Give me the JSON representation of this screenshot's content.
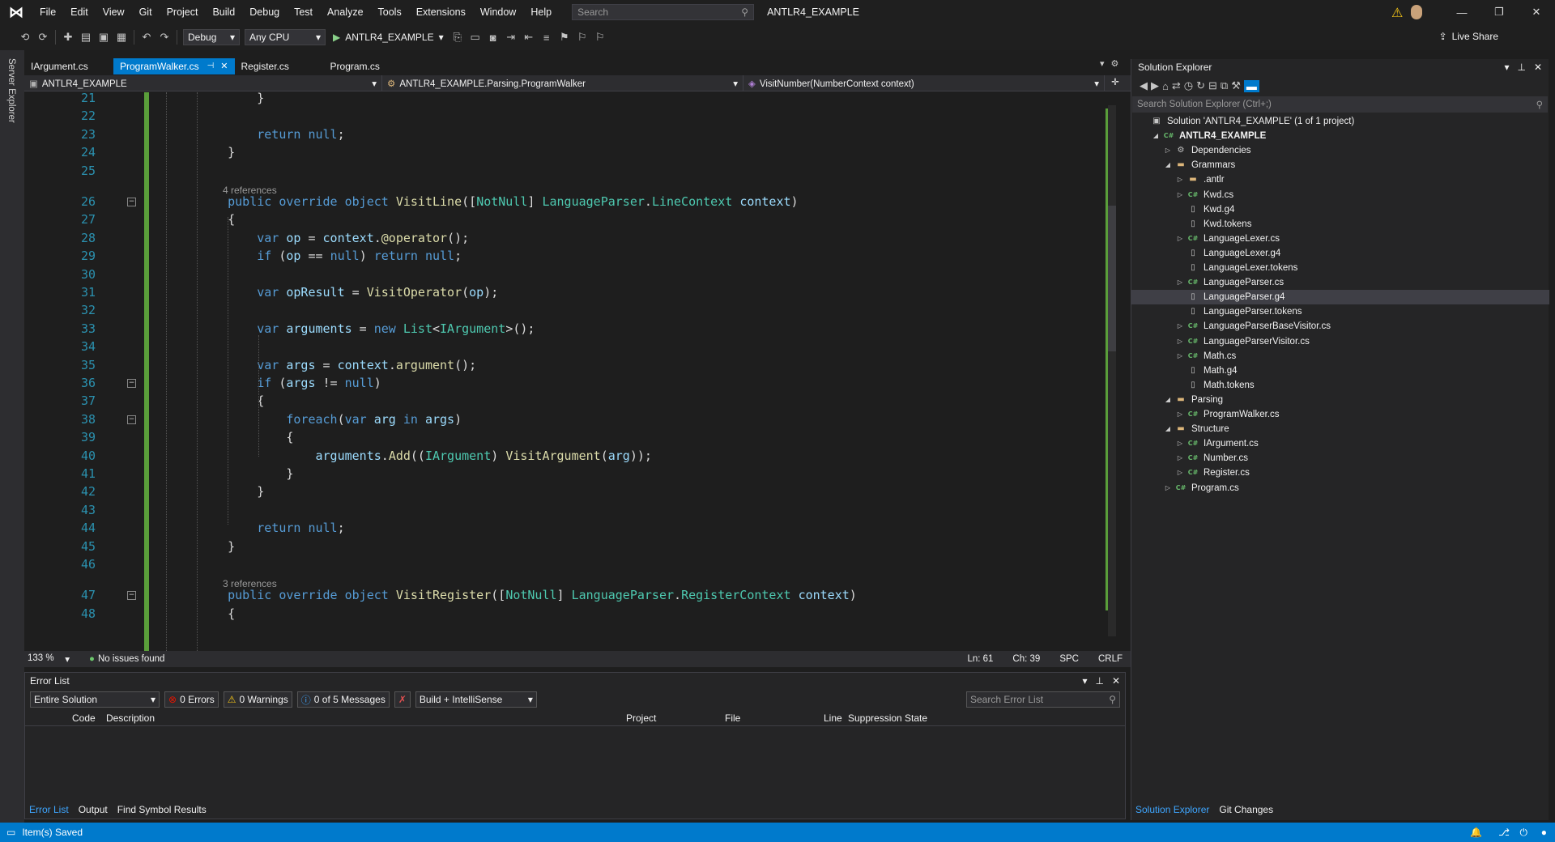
{
  "title_bar": {
    "menu": [
      "File",
      "Edit",
      "View",
      "Git",
      "Project",
      "Build",
      "Debug",
      "Test",
      "Analyze",
      "Tools",
      "Extensions",
      "Window",
      "Help"
    ],
    "search_placeholder": "Search",
    "solution_name": "ANTLR4_EXAMPLE"
  },
  "toolbar": {
    "config": "Debug",
    "platform": "Any CPU",
    "run_target": "ANTLR4_EXAMPLE",
    "live_share": "Live Share"
  },
  "left_strip": {
    "server_explorer": "Server Explorer"
  },
  "doc_tabs": [
    {
      "label": "IArgument.cs",
      "active": false
    },
    {
      "label": "ProgramWalker.cs",
      "active": true
    },
    {
      "label": "Register.cs",
      "active": false
    },
    {
      "label": "Program.cs",
      "active": false
    }
  ],
  "navbar": {
    "project": "ANTLR4_EXAMPLE",
    "class": "ANTLR4_EXAMPLE.Parsing.ProgramWalker",
    "member": "VisitNumber(NumberContext context)"
  },
  "editor": {
    "lines": [
      {
        "n": "21",
        "text": "        }"
      },
      {
        "n": "22",
        "text": ""
      },
      {
        "n": "23",
        "text": "        return null;"
      },
      {
        "n": "24",
        "text": "    }"
      },
      {
        "n": "25",
        "text": ""
      },
      {
        "refs": "4 references"
      },
      {
        "n": "26",
        "text": "    public override object VisitLine([NotNull] LanguageParser.LineContext context)"
      },
      {
        "n": "27",
        "text": "    {"
      },
      {
        "n": "28",
        "text": "        var op = context.@operator();"
      },
      {
        "n": "29",
        "text": "        if (op == null) return null;"
      },
      {
        "n": "30",
        "text": ""
      },
      {
        "n": "31",
        "text": "        var opResult = VisitOperator(op);"
      },
      {
        "n": "32",
        "text": ""
      },
      {
        "n": "33",
        "text": "        var arguments = new List<IArgument>();"
      },
      {
        "n": "34",
        "text": ""
      },
      {
        "n": "35",
        "text": "        var args = context.argument();"
      },
      {
        "n": "36",
        "text": "        if (args != null)"
      },
      {
        "n": "37",
        "text": "        {"
      },
      {
        "n": "38",
        "text": "            foreach(var arg in args)"
      },
      {
        "n": "39",
        "text": "            {"
      },
      {
        "n": "40",
        "text": "                arguments.Add((IArgument) VisitArgument(arg));"
      },
      {
        "n": "41",
        "text": "            }"
      },
      {
        "n": "42",
        "text": "        }"
      },
      {
        "n": "43",
        "text": ""
      },
      {
        "n": "44",
        "text": "        return null;"
      },
      {
        "n": "45",
        "text": "    }"
      },
      {
        "n": "46",
        "text": ""
      },
      {
        "refs": "3 references"
      },
      {
        "n": "47",
        "text": "    public override object VisitRegister([NotNull] LanguageParser.RegisterContext context)"
      },
      {
        "n": "48",
        "text": "    {"
      }
    ]
  },
  "editor_status": {
    "zoom": "133 %",
    "issues": "No issues found",
    "ln": "Ln: 61",
    "ch": "Ch: 39",
    "spc": "SPC",
    "eol": "CRLF"
  },
  "error_list": {
    "title": "Error List",
    "scope": "Entire Solution",
    "errors": "0 Errors",
    "warnings": "0 Warnings",
    "messages": "0 of 5 Messages",
    "build_filter": "Build + IntelliSense",
    "search_placeholder": "Search Error List",
    "columns": [
      "Code",
      "Description",
      "Project",
      "File",
      "Line",
      "Suppression State"
    ],
    "tabs": [
      "Error List",
      "Output",
      "Find Symbol Results"
    ]
  },
  "solution_explorer": {
    "title": "Solution Explorer",
    "search_placeholder": "Search Solution Explorer (Ctrl+;)",
    "tree": [
      {
        "label": "Solution 'ANTLR4_EXAMPLE' (1 of 1 project)",
        "depth": 0,
        "icon": "solution",
        "tw": ""
      },
      {
        "label": "ANTLR4_EXAMPLE",
        "depth": 1,
        "icon": "project",
        "tw": "open",
        "bold": true
      },
      {
        "label": "Dependencies",
        "depth": 2,
        "icon": "deps",
        "tw": "closed"
      },
      {
        "label": "Grammars",
        "depth": 2,
        "icon": "folder",
        "tw": "open"
      },
      {
        "label": ".antlr",
        "depth": 3,
        "icon": "folder",
        "tw": "closed"
      },
      {
        "label": "Kwd.cs",
        "depth": 3,
        "icon": "cs",
        "tw": "closed"
      },
      {
        "label": "Kwd.g4",
        "depth": 3,
        "icon": "file",
        "tw": ""
      },
      {
        "label": "Kwd.tokens",
        "depth": 3,
        "icon": "file",
        "tw": ""
      },
      {
        "label": "LanguageLexer.cs",
        "depth": 3,
        "icon": "cs",
        "tw": "closed"
      },
      {
        "label": "LanguageLexer.g4",
        "depth": 3,
        "icon": "file",
        "tw": ""
      },
      {
        "label": "LanguageLexer.tokens",
        "depth": 3,
        "icon": "file",
        "tw": ""
      },
      {
        "label": "LanguageParser.cs",
        "depth": 3,
        "icon": "cs",
        "tw": "closed"
      },
      {
        "label": "LanguageParser.g4",
        "depth": 3,
        "icon": "file",
        "tw": "",
        "selected": true
      },
      {
        "label": "LanguageParser.tokens",
        "depth": 3,
        "icon": "file",
        "tw": ""
      },
      {
        "label": "LanguageParserBaseVisitor.cs",
        "depth": 3,
        "icon": "cs",
        "tw": "closed"
      },
      {
        "label": "LanguageParserVisitor.cs",
        "depth": 3,
        "icon": "cs",
        "tw": "closed"
      },
      {
        "label": "Math.cs",
        "depth": 3,
        "icon": "cs",
        "tw": "closed"
      },
      {
        "label": "Math.g4",
        "depth": 3,
        "icon": "file",
        "tw": ""
      },
      {
        "label": "Math.tokens",
        "depth": 3,
        "icon": "file",
        "tw": ""
      },
      {
        "label": "Parsing",
        "depth": 2,
        "icon": "folder",
        "tw": "open"
      },
      {
        "label": "ProgramWalker.cs",
        "depth": 3,
        "icon": "cs",
        "tw": "closed"
      },
      {
        "label": "Structure",
        "depth": 2,
        "icon": "folder",
        "tw": "open"
      },
      {
        "label": "IArgument.cs",
        "depth": 3,
        "icon": "cs",
        "tw": "closed"
      },
      {
        "label": "Number.cs",
        "depth": 3,
        "icon": "cs",
        "tw": "closed"
      },
      {
        "label": "Register.cs",
        "depth": 3,
        "icon": "cs",
        "tw": "closed"
      },
      {
        "label": "Program.cs",
        "depth": 2,
        "icon": "cs",
        "tw": "closed"
      }
    ],
    "tabs": [
      "Solution Explorer",
      "Git Changes"
    ]
  },
  "statusbar": {
    "message": "Item(s) Saved"
  },
  "colors": {
    "accent": "#007acc",
    "keyword": "#569cd6",
    "type": "#4ec9b0",
    "method": "#dcdcaa",
    "variable": "#9cdcfe"
  }
}
